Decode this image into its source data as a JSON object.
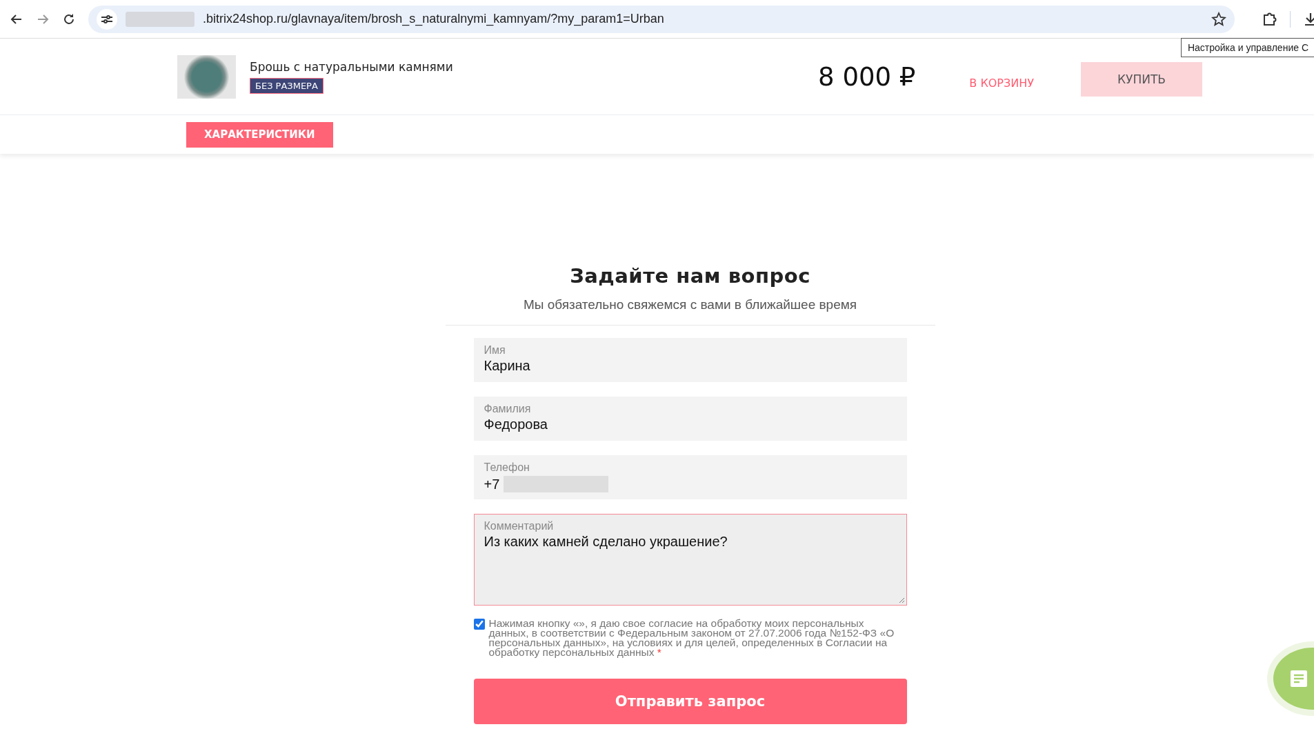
{
  "browser": {
    "url": ".bitrix24shop.ru/glavnaya/item/brosh_s_naturalnymi_kamnyam/?my_param1=Urban",
    "tooltip": "Настройка и управление С"
  },
  "product": {
    "title": "Брошь с натуральными камнями",
    "size_badge": "БЕЗ РАЗМЕРА",
    "price": "8 000 ₽",
    "cart_link": "В КОРЗИНУ",
    "buy_button": "КУПИТЬ"
  },
  "nav": {
    "tabs": [
      {
        "label": "ХАРАКТЕРИСТИКИ",
        "selected": true
      }
    ]
  },
  "form": {
    "title": "Задайте нам вопрос",
    "subtitle": "Мы обязательно свяжемся с вами в ближайшее время",
    "fields": [
      {
        "kind": "input",
        "label": "Имя",
        "value": "Карина"
      },
      {
        "kind": "input",
        "label": "Фамилия",
        "value": "Федорова"
      },
      {
        "kind": "phone",
        "label": "Телефон",
        "value": "+7"
      },
      {
        "kind": "textarea",
        "label": "Комментарий",
        "value": "Из каких камней сделано украшение?"
      }
    ],
    "consent": {
      "checked": true,
      "text": "Нажимая кнопку «», я даю свое согласие на обработку моих персональных данных, в соответствии с Федеральным законом от 27.07.2006 года №152-ФЗ «О персональных данных», на условиях и для целей, определенных в Согласии на обработку персональных данных",
      "required_mark": "*"
    },
    "submit": "Отправить запрос"
  }
}
